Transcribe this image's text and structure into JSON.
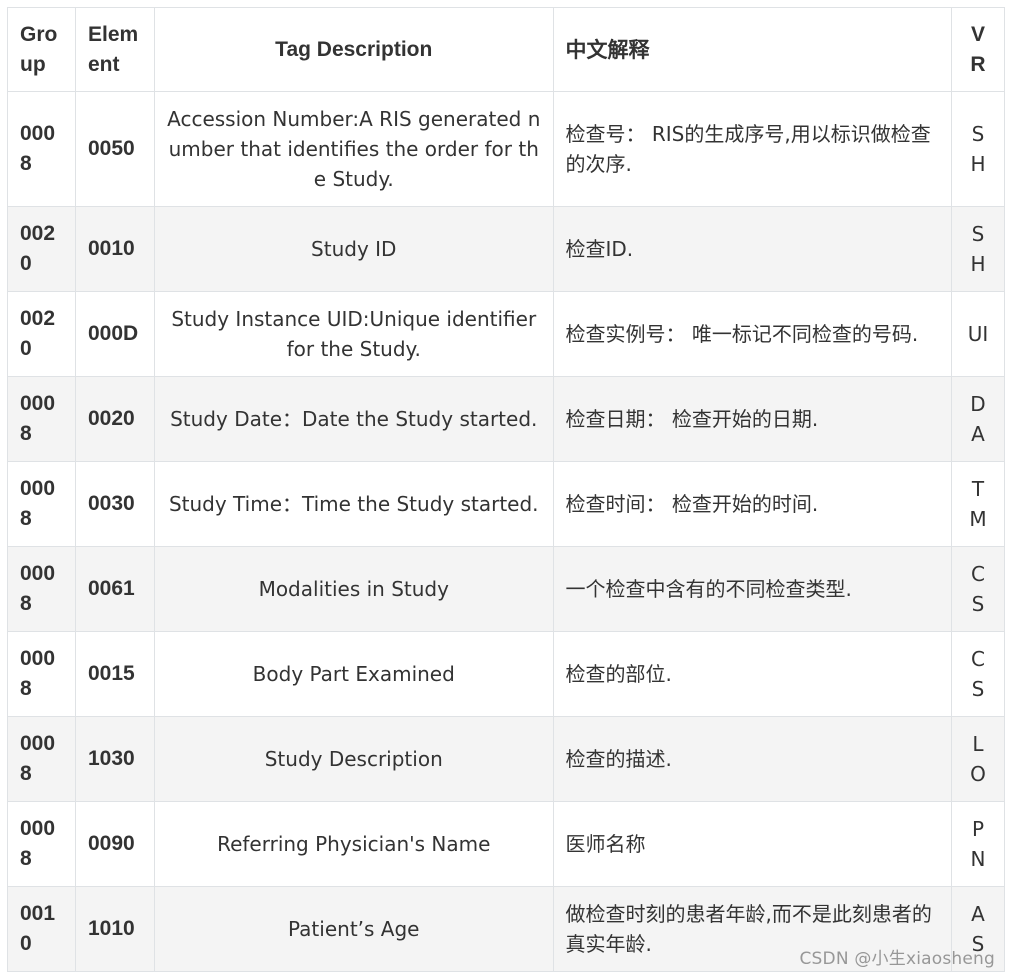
{
  "table": {
    "headers": [
      "Group",
      "Element",
      "Tag Description",
      "中文解释",
      "VR"
    ],
    "rows": [
      {
        "group": "0008",
        "element": "0050",
        "description": "Accession Number:A RIS generated number that identifies the order for the Study.",
        "chinese": "检查号： RIS的生成序号,用以标识做检查的次序.",
        "vr": "SH"
      },
      {
        "group": "0020",
        "element": "0010",
        "description": "Study ID",
        "chinese": "检查ID.",
        "vr": "SH"
      },
      {
        "group": "0020",
        "element": "000D",
        "description": "Study Instance UID:Unique identifier for the Study.",
        "chinese": "检查实例号： 唯一标记不同检查的号码.",
        "vr": "UI"
      },
      {
        "group": "0008",
        "element": "0020",
        "description": "Study Date：Date the Study started.",
        "chinese": "检查日期： 检查开始的日期.",
        "vr": "DA"
      },
      {
        "group": "0008",
        "element": "0030",
        "description": "Study Time：Time the Study started.",
        "chinese": "检查时间： 检查开始的时间.",
        "vr": "TM"
      },
      {
        "group": "0008",
        "element": "0061",
        "description": "Modalities in Study",
        "chinese": "一个检查中含有的不同检查类型.",
        "vr": "CS"
      },
      {
        "group": "0008",
        "element": "0015",
        "description": "Body Part Examined",
        "chinese": "检查的部位.",
        "vr": "CS"
      },
      {
        "group": "0008",
        "element": "1030",
        "description": "Study Description",
        "chinese": "检查的描述.",
        "vr": "LO"
      },
      {
        "group": "0008",
        "element": "0090",
        "description": "Referring Physician's Name",
        "chinese": "医师名称",
        "vr": "PN"
      },
      {
        "group": "0010",
        "element": "1010",
        "description": "Patient’s Age",
        "chinese": "做检查时刻的患者年龄,而不是此刻患者的真实年龄.",
        "vr": "AS"
      }
    ]
  },
  "watermark": "CSDN @小生xiaosheng"
}
